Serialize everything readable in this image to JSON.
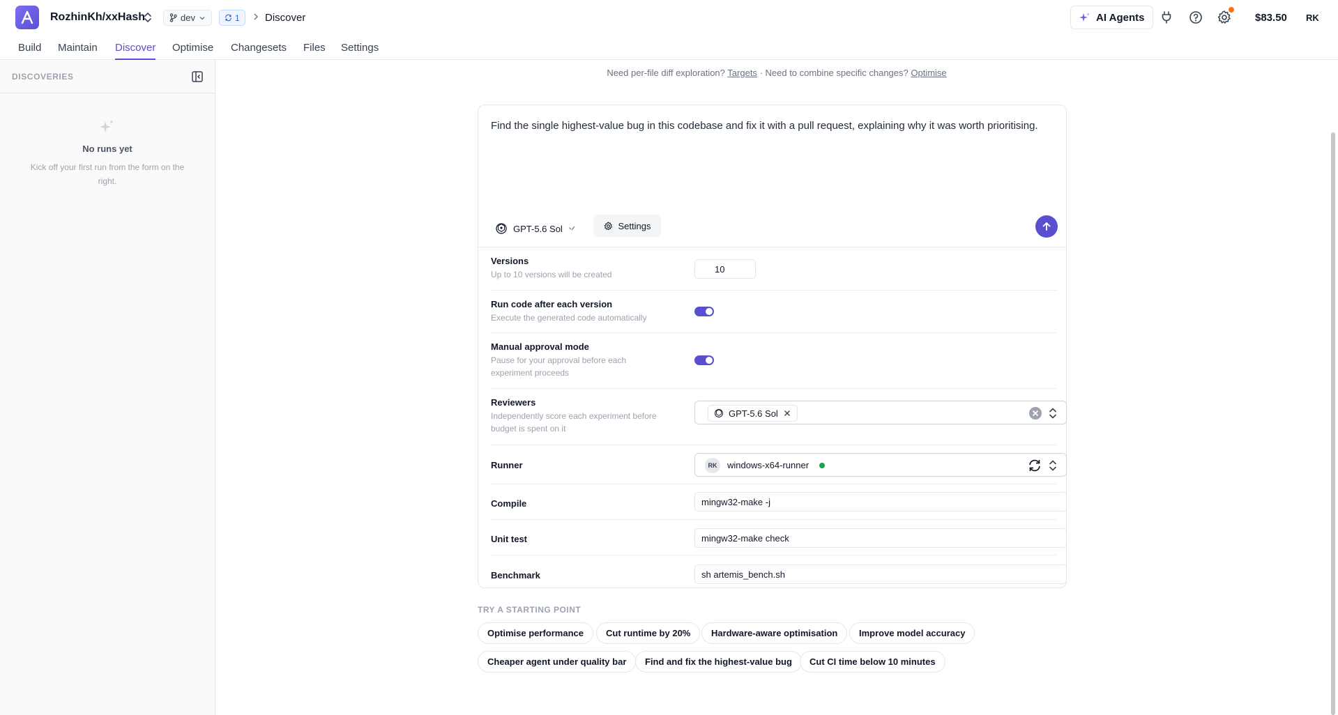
{
  "header": {
    "repo": "RozhinKh/xxHash",
    "branch": "dev",
    "sync_count": "1",
    "breadcrumb": "Discover",
    "agents_label": "AI Agents",
    "balance": "$83.50",
    "user_initials": "RK"
  },
  "tabs": [
    {
      "label": "Build"
    },
    {
      "label": "Maintain"
    },
    {
      "label": "Discover"
    },
    {
      "label": "Optimise"
    },
    {
      "label": "Changesets"
    },
    {
      "label": "Files"
    },
    {
      "label": "Settings"
    }
  ],
  "active_tab": "Discover",
  "sidebar": {
    "title": "DISCOVERIES",
    "empty_title": "No runs yet",
    "empty_sub": "Kick off your first run from the form on the right."
  },
  "hint": {
    "part1": "Need per-file diff exploration?",
    "link1": "Targets",
    "part2": "· Need to combine specific changes?",
    "link2": "Optimise"
  },
  "composer": {
    "prompt": "Find the single highest-value bug in this codebase and fix it with a pull request, explaining why it was worth prioritising.",
    "model": "GPT-5.6 Sol",
    "settings_label": "Settings"
  },
  "settings": {
    "versions_label": "Versions",
    "versions_desc": "Up to 10 versions will be created",
    "versions_value": "10",
    "run_code_label": "Run code after each version",
    "run_code_desc": "Execute the generated code automatically",
    "run_code_on": true,
    "manual_label": "Manual approval mode",
    "manual_desc": "Pause for your approval before each experiment proceeds",
    "manual_on": true,
    "reviewers_label": "Reviewers",
    "reviewers_desc": "Independently score each experiment before budget is spent on it",
    "reviewer_chip": "GPT-5.6 Sol",
    "runner_label": "Runner",
    "runner_initials": "RK",
    "runner_name": "windows-x64-runner",
    "compile_label": "Compile",
    "compile_value": "mingw32-make -j",
    "unittest_label": "Unit test",
    "unittest_value": "mingw32-make check",
    "benchmark_label": "Benchmark",
    "benchmark_value": "sh artemis_bench.sh"
  },
  "starting_points": {
    "title": "TRY A STARTING POINT",
    "items": [
      "Optimise performance",
      "Cut runtime by 20%",
      "Hardware-aware optimisation",
      "Improve model accuracy",
      "Cheaper agent under quality bar",
      "Find and fix the highest-value bug",
      "Cut CI time below 10 minutes"
    ]
  },
  "colors": {
    "accent": "#5b4fd1",
    "status_online": "#16a34a",
    "notification": "#f97316"
  }
}
